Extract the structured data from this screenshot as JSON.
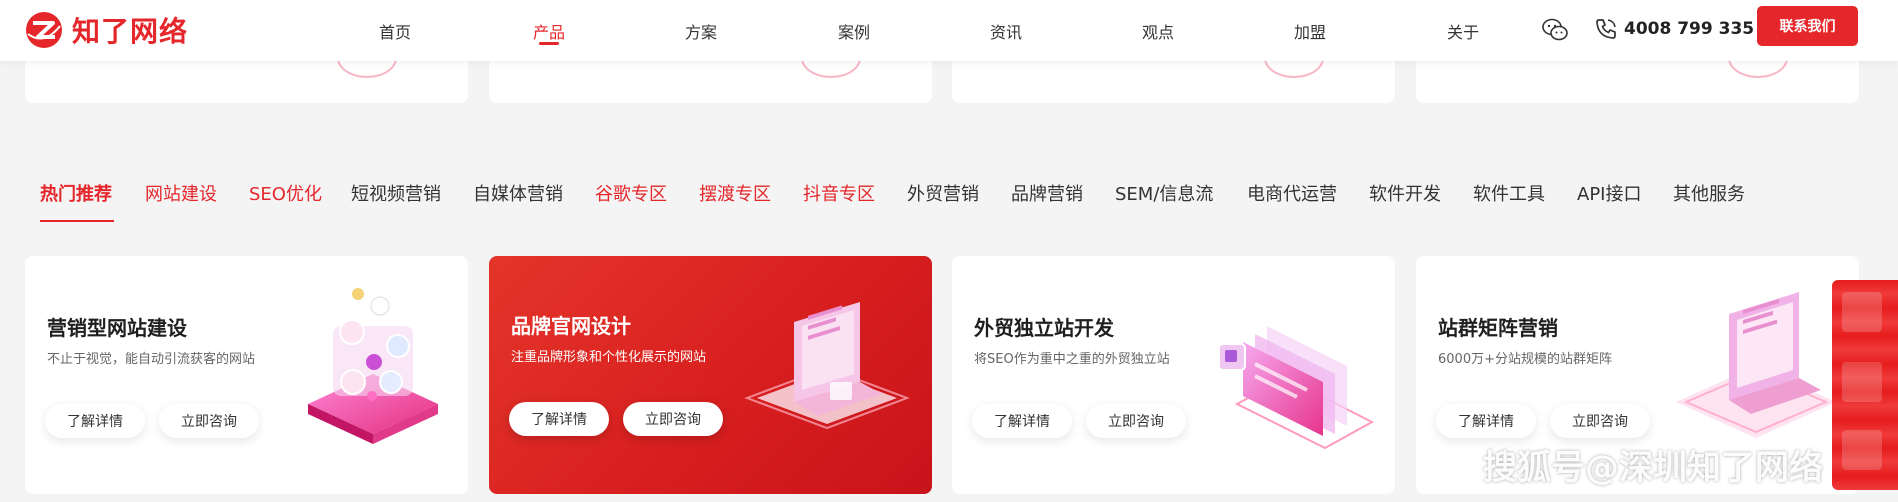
{
  "header": {
    "logo_text": "知了网络",
    "nav": [
      "首页",
      "产品",
      "方案",
      "案例",
      "资讯",
      "观点",
      "加盟",
      "关于"
    ],
    "active_nav": "产品",
    "phone": "4008 799 335",
    "contact_button": "联系我们"
  },
  "tabs": {
    "items": [
      {
        "label": "热门推荐",
        "state": "active"
      },
      {
        "label": "网站建设",
        "state": "red"
      },
      {
        "label": "SEO优化",
        "state": "red"
      },
      {
        "label": "短视频营销",
        "state": "normal"
      },
      {
        "label": "自媒体营销",
        "state": "normal"
      },
      {
        "label": "谷歌专区",
        "state": "red"
      },
      {
        "label": "摆渡专区",
        "state": "red"
      },
      {
        "label": "抖音专区",
        "state": "red"
      },
      {
        "label": "外贸营销",
        "state": "normal"
      },
      {
        "label": "品牌营销",
        "state": "normal"
      },
      {
        "label": "SEM/信息流",
        "state": "normal"
      },
      {
        "label": "电商代运营",
        "state": "normal"
      },
      {
        "label": "软件开发",
        "state": "normal"
      },
      {
        "label": "软件工具",
        "state": "normal"
      },
      {
        "label": "API接口",
        "state": "normal"
      },
      {
        "label": "其他服务",
        "state": "normal"
      }
    ]
  },
  "cards": [
    {
      "title": "营销型网站建设",
      "subtitle": "不止于视觉，能自动引流获客的网站",
      "btn_detail": "了解详情",
      "btn_consult": "立即咨询",
      "featured": false
    },
    {
      "title": "品牌官网设计",
      "subtitle": "注重品牌形象和个性化展示的网站",
      "btn_detail": "了解详情",
      "btn_consult": "立即咨询",
      "featured": true
    },
    {
      "title": "外贸独立站开发",
      "subtitle": "将SEO作为重中之重的外贸独立站",
      "btn_detail": "了解详情",
      "btn_consult": "立即咨询",
      "featured": false
    },
    {
      "title": "站群矩阵营销",
      "subtitle": "6000万+分站规模的站群矩阵",
      "btn_detail": "了解详情",
      "btn_consult": "立即咨询",
      "featured": false
    }
  ],
  "watermark": "搜狐号@深圳知了网络",
  "colors": {
    "brand_red": "#e5262a",
    "background": "#f4f4f5"
  },
  "icons": {
    "logo": "zhiliao-logo-icon",
    "wechat": "wechat-icon",
    "phone": "phone-icon"
  }
}
